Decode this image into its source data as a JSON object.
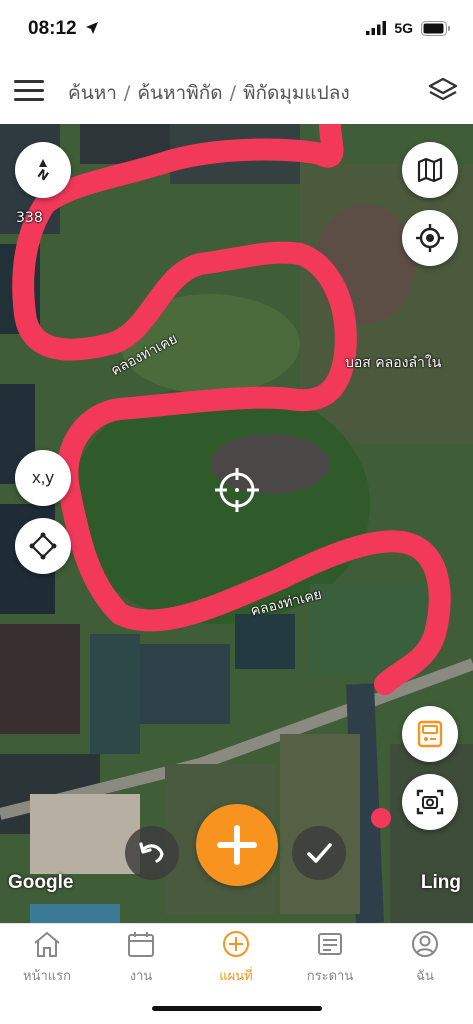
{
  "status": {
    "time": "08:12",
    "network": "5G"
  },
  "header": {
    "breadcrumb": [
      "ค้นหา",
      "ค้นหาพิกัด",
      "พิกัดมุมแปลง"
    ],
    "separator": "/"
  },
  "map": {
    "compass_label": "N",
    "coord_button_label": "x,y",
    "place_labels": {
      "road_number": "338",
      "canal_1": "คลองท่าเคย",
      "canal_2": "คลองท่าเคย",
      "poi": "บอส คลองลำใน"
    },
    "attribution_left": "Google",
    "attribution_right": "Ling"
  },
  "tabs": [
    {
      "label": "หน้าแรก",
      "icon": "home-icon",
      "active": false
    },
    {
      "label": "งาน",
      "icon": "calendar-icon",
      "active": false
    },
    {
      "label": "แผนที่",
      "icon": "plus-circle-icon",
      "active": true
    },
    {
      "label": "กระดาน",
      "icon": "board-icon",
      "active": false
    },
    {
      "label": "ฉัน",
      "icon": "profile-icon",
      "active": false
    }
  ],
  "colors": {
    "accent": "#f7931e",
    "route": "#f2395a"
  }
}
